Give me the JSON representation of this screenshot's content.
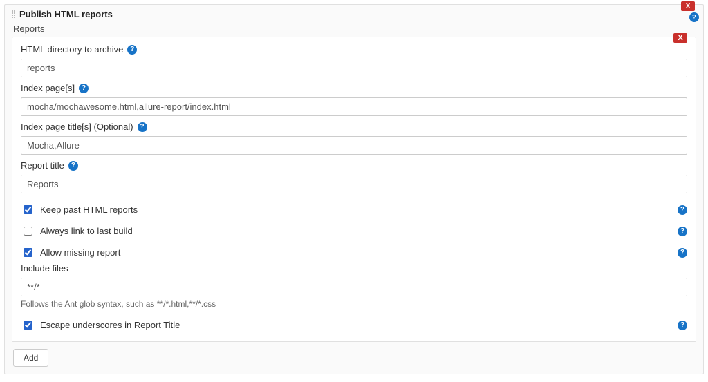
{
  "section": {
    "title": "Publish HTML reports",
    "reports_label": "Reports"
  },
  "fields": {
    "html_dir": {
      "label": "HTML directory to archive",
      "value": "reports"
    },
    "index_pages": {
      "label": "Index page[s]",
      "value": "mocha/mochawesome.html,allure-report/index.html"
    },
    "index_titles": {
      "label": "Index page title[s] (Optional)",
      "value": "Mocha,Allure"
    },
    "report_title": {
      "label": "Report title",
      "value": "Reports"
    },
    "include_files": {
      "label": "Include files",
      "value": "**/*",
      "hint": "Follows the Ant glob syntax, such as **/*.html,**/*.css"
    }
  },
  "checkboxes": {
    "keep_past": {
      "label": "Keep past HTML reports",
      "checked": true
    },
    "always_link": {
      "label": "Always link to last build",
      "checked": false
    },
    "allow_missing": {
      "label": "Allow missing report",
      "checked": true
    },
    "escape_underscores": {
      "label": "Escape underscores in Report Title",
      "checked": true
    }
  },
  "buttons": {
    "add": "Add",
    "close": "X"
  },
  "icons": {
    "help_glyph": "?"
  }
}
